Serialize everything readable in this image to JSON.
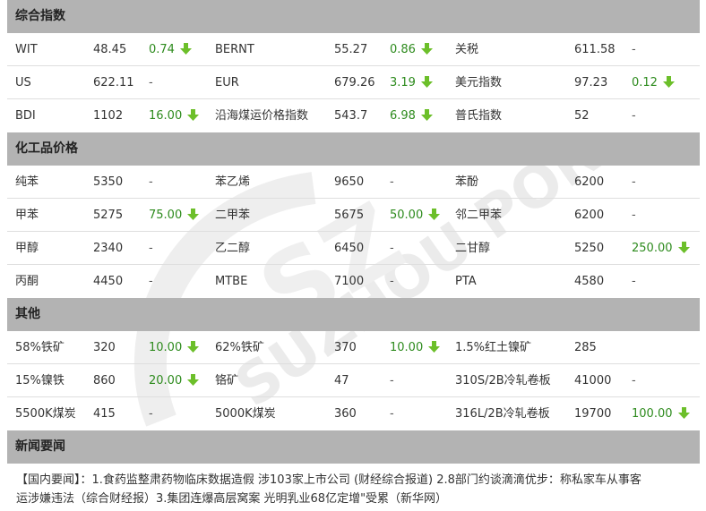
{
  "sections": [
    {
      "title": "综合指数",
      "rows": [
        [
          {
            "name": "WIT",
            "value": "48.45",
            "change": "0.74",
            "dir": "down"
          },
          {
            "name": "BERNT",
            "value": "55.27",
            "change": "0.86",
            "dir": "down"
          },
          {
            "name": "关税",
            "value": "611.58",
            "change": "-",
            "dir": "none"
          }
        ],
        [
          {
            "name": "US",
            "value": "622.11",
            "change": "-",
            "dir": "none"
          },
          {
            "name": "EUR",
            "value": "679.26",
            "change": "3.19",
            "dir": "down"
          },
          {
            "name": "美元指数",
            "value": "97.23",
            "change": "0.12",
            "dir": "down"
          }
        ],
        [
          {
            "name": "BDI",
            "value": "1102",
            "change": "16.00",
            "dir": "down"
          },
          {
            "name": "沿海煤运价格指数",
            "value": "543.7",
            "change": "6.98",
            "dir": "down"
          },
          {
            "name": "普氏指数",
            "value": "52",
            "change": "-",
            "dir": "none"
          }
        ]
      ]
    },
    {
      "title": "化工品价格",
      "rows": [
        [
          {
            "name": "纯苯",
            "value": "5350",
            "change": "-",
            "dir": "none"
          },
          {
            "name": "苯乙烯",
            "value": "9650",
            "change": "-",
            "dir": "none"
          },
          {
            "name": "苯酚",
            "value": "6200",
            "change": "-",
            "dir": "none"
          }
        ],
        [
          {
            "name": "甲苯",
            "value": "5275",
            "change": "75.00",
            "dir": "down"
          },
          {
            "name": "二甲苯",
            "value": "5675",
            "change": "50.00",
            "dir": "down"
          },
          {
            "name": "邻二甲苯",
            "value": "6200",
            "change": "-",
            "dir": "none"
          }
        ],
        [
          {
            "name": "甲醇",
            "value": "2340",
            "change": "-",
            "dir": "none"
          },
          {
            "name": "乙二醇",
            "value": "6450",
            "change": "-",
            "dir": "none"
          },
          {
            "name": "二甘醇",
            "value": "5250",
            "change": "250.00",
            "dir": "down"
          }
        ],
        [
          {
            "name": "丙酮",
            "value": "4450",
            "change": "-",
            "dir": "none"
          },
          {
            "name": "MTBE",
            "value": "7100",
            "change": "-",
            "dir": "none"
          },
          {
            "name": "PTA",
            "value": "4580",
            "change": "-",
            "dir": "none"
          }
        ]
      ]
    },
    {
      "title": "其他",
      "rows": [
        [
          {
            "name": "58%铁矿",
            "value": "320",
            "change": "10.00",
            "dir": "down"
          },
          {
            "name": "62%铁矿",
            "value": "370",
            "change": "10.00",
            "dir": "down"
          },
          {
            "name": "1.5%红土镍矿",
            "value": "285",
            "change": "",
            "dir": "none"
          }
        ],
        [
          {
            "name": "15%镍铁",
            "value": "860",
            "change": "20.00",
            "dir": "down"
          },
          {
            "name": "铬矿",
            "value": "47",
            "change": "-",
            "dir": "none"
          },
          {
            "name": "310S/2B冷轧卷板",
            "value": "41000",
            "change": "-",
            "dir": "none"
          }
        ],
        [
          {
            "name": "5500K煤炭",
            "value": "415",
            "change": "-",
            "dir": "none"
          },
          {
            "name": "5000K煤炭",
            "value": "360",
            "change": "-",
            "dir": "none"
          },
          {
            "name": "316L/2B冷轧卷板",
            "value": "19700",
            "change": "100.00",
            "dir": "down"
          }
        ]
      ]
    }
  ],
  "news": {
    "title": "新闻要闻",
    "line1": "【国内要闻】：1.食药监整肃药物临床数据造假 涉103家上市公司 (财经综合报道) 2.8部门约谈滴滴优步：称私家车从事客",
    "line2": "运涉嫌违法（综合财经报）3.集团连爆高层窝案 光明乳业68亿定增\"受累（新华网）"
  },
  "watermark_text": "SUZHOU PORT",
  "colors": {
    "header_bg": "#b3b3b3",
    "change_green": "#2e8b1e",
    "arrow_green": "#6cbf2a"
  }
}
